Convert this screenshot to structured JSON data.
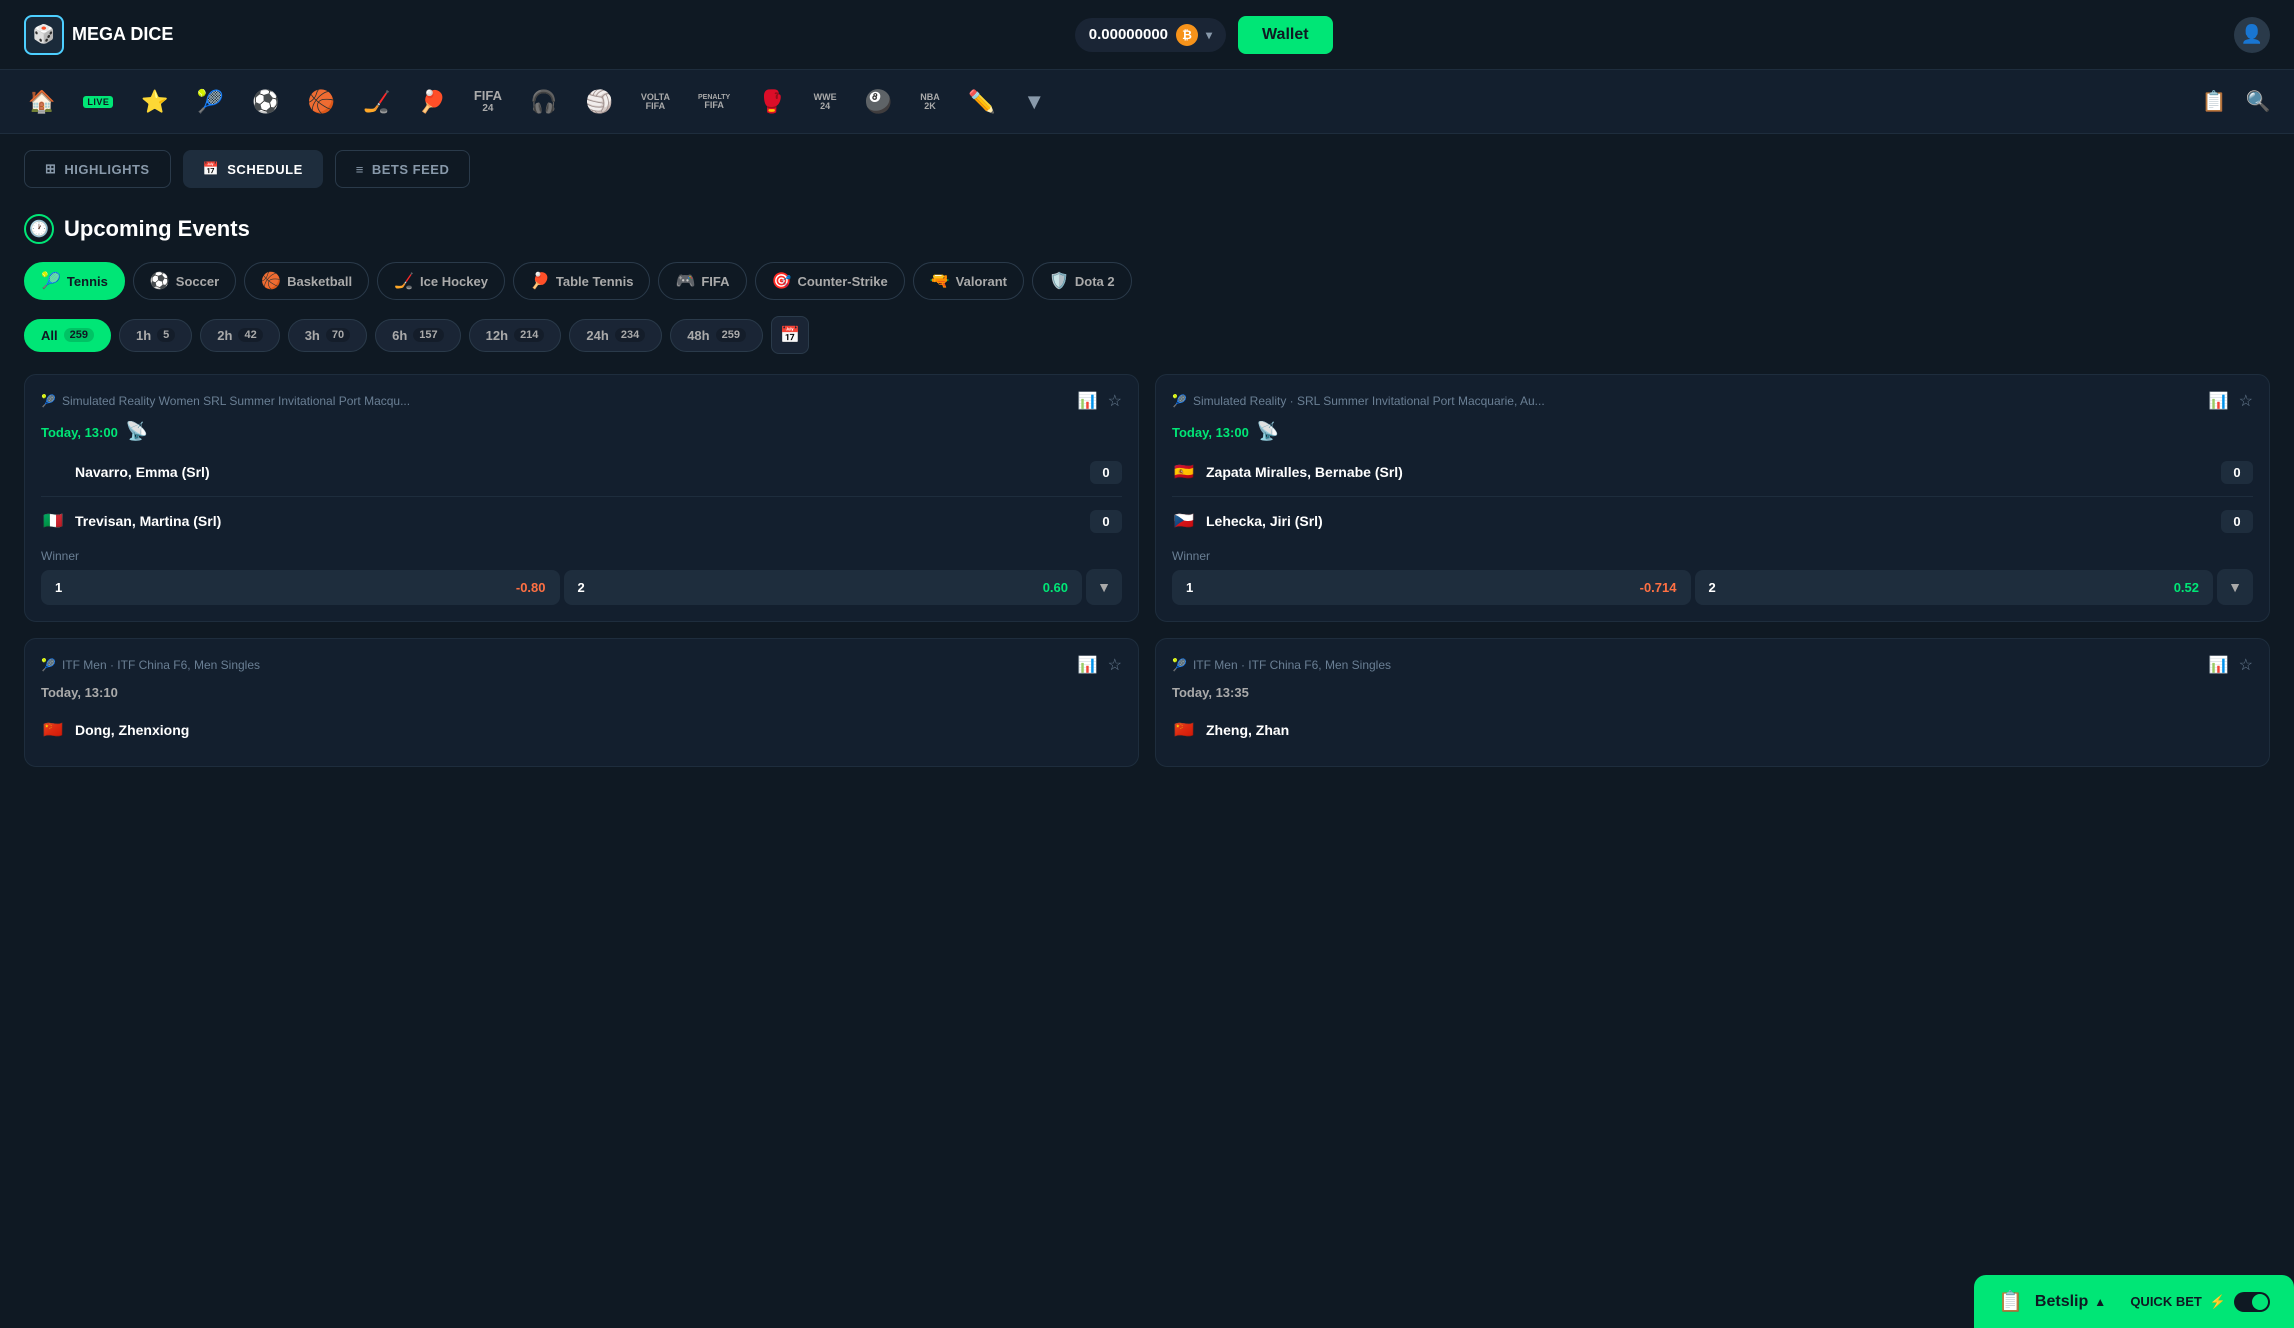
{
  "header": {
    "logo": "MEGA DICE",
    "balance": "0.00000000",
    "currency": "BTC",
    "wallet_label": "Wallet"
  },
  "nav": {
    "items": [
      {
        "id": "home",
        "icon": "🏠",
        "label": "Home"
      },
      {
        "id": "live",
        "icon": "LIVE",
        "label": "Live"
      },
      {
        "id": "favorites",
        "icon": "⭐",
        "label": "Favorites"
      },
      {
        "id": "tennis",
        "icon": "🎾",
        "label": "Tennis"
      },
      {
        "id": "soccer",
        "icon": "⚽",
        "label": "Soccer"
      },
      {
        "id": "basketball",
        "icon": "🏀",
        "label": "Basketball"
      },
      {
        "id": "hockey-stick",
        "icon": "🏒",
        "label": "Ice Hockey"
      },
      {
        "id": "table-tennis",
        "icon": "🏓",
        "label": "Table Tennis"
      },
      {
        "id": "fifa24",
        "icon": "FIFA\n24",
        "label": "FIFA 24"
      },
      {
        "id": "esports",
        "icon": "🎧",
        "label": "Esports"
      },
      {
        "id": "volleyball",
        "icon": "🏐",
        "label": "Volleyball"
      },
      {
        "id": "volta",
        "icon": "VOLTA\nFIFA",
        "label": "Volta FIFA"
      },
      {
        "id": "penalty",
        "icon": "PENALTY\nFIFA",
        "label": "Penalty FIFA"
      },
      {
        "id": "futsal",
        "icon": "🥊",
        "label": "Futsal"
      },
      {
        "id": "wwe",
        "icon": "WWE\n24",
        "label": "WWE 24"
      },
      {
        "id": "pool",
        "icon": "🎱",
        "label": "Pool"
      },
      {
        "id": "nba2k",
        "icon": "NBA\n2K",
        "label": "NBA 2K"
      },
      {
        "id": "more",
        "icon": "✏️",
        "label": "More"
      },
      {
        "id": "expand",
        "icon": "▼",
        "label": "Expand"
      }
    ],
    "right_items": [
      {
        "id": "betslip-nav",
        "icon": "📋"
      },
      {
        "id": "search-nav",
        "icon": "🔍"
      }
    ]
  },
  "tabs": [
    {
      "id": "highlights",
      "label": "HIGHLIGHTS",
      "icon": "⊞",
      "active": false
    },
    {
      "id": "schedule",
      "label": "SCHEDULE",
      "icon": "📅",
      "active": true
    },
    {
      "id": "bets-feed",
      "label": "BETS FEED",
      "icon": "≡",
      "active": false
    }
  ],
  "upcoming": {
    "title": "Upcoming Events",
    "sports": [
      {
        "id": "tennis",
        "icon": "🎾",
        "label": "Tennis",
        "active": true
      },
      {
        "id": "soccer",
        "icon": "⚽",
        "label": "Soccer",
        "active": false
      },
      {
        "id": "basketball",
        "icon": "🏀",
        "label": "Basketball",
        "active": false
      },
      {
        "id": "ice-hockey",
        "icon": "🏒",
        "label": "Ice Hockey",
        "active": false
      },
      {
        "id": "table-tennis",
        "icon": "🏓",
        "label": "Table Tennis",
        "active": false
      },
      {
        "id": "fifa",
        "icon": "🎮",
        "label": "FIFA",
        "active": false
      },
      {
        "id": "counter-strike",
        "icon": "🎯",
        "label": "Counter-Strike",
        "active": false
      },
      {
        "id": "valorant",
        "icon": "🔫",
        "label": "Valorant",
        "active": false
      },
      {
        "id": "dota2",
        "icon": "🛡️",
        "label": "Dota 2",
        "active": false
      }
    ],
    "time_filters": [
      {
        "id": "all",
        "label": "All",
        "count": 259,
        "active": true
      },
      {
        "id": "1h",
        "label": "1h",
        "count": 5,
        "active": false
      },
      {
        "id": "2h",
        "label": "2h",
        "count": 42,
        "active": false
      },
      {
        "id": "3h",
        "label": "3h",
        "count": 70,
        "active": false
      },
      {
        "id": "6h",
        "label": "6h",
        "count": 157,
        "active": false
      },
      {
        "id": "12h",
        "label": "12h",
        "count": 214,
        "active": false
      },
      {
        "id": "24h",
        "label": "24h",
        "count": 234,
        "active": false
      },
      {
        "id": "48h",
        "label": "48h",
        "count": 259,
        "active": false
      }
    ],
    "events": [
      {
        "id": "event1",
        "meta": "Simulated Reality Women SRL Summer Invitational Port Macqu...",
        "time": "Today, 13:00",
        "live": true,
        "player1": {
          "name": "Navarro, Emma (Srl)",
          "flag": "",
          "score": "0"
        },
        "player2": {
          "name": "Trevisan, Martina (Srl)",
          "flag": "🇮🇹",
          "score": "0"
        },
        "winner_label": "Winner",
        "odds": [
          {
            "side": "1",
            "val": "-0.80",
            "positive": false
          },
          {
            "side": "2",
            "val": "0.60",
            "positive": true
          }
        ]
      },
      {
        "id": "event2",
        "meta": "Simulated Reality · SRL Summer Invitational Port Macquarie, Au...",
        "time": "Today, 13:00",
        "live": true,
        "player1": {
          "name": "Zapata Miralles, Bernabe (Srl)",
          "flag": "🇪🇸",
          "score": "0"
        },
        "player2": {
          "name": "Lehecka, Jiri (Srl)",
          "flag": "🇨🇿",
          "score": "0"
        },
        "winner_label": "Winner",
        "odds": [
          {
            "side": "1",
            "val": "-0.714",
            "positive": false
          },
          {
            "side": "2",
            "val": "0.52",
            "positive": true
          }
        ]
      },
      {
        "id": "event3",
        "meta": "ITF Men · ITF China F6, Men Singles",
        "time": "Today, 13:10",
        "live": false,
        "player1": {
          "name": "Dong, Zhenxiong",
          "flag": "🇨🇳",
          "score": ""
        },
        "player2": {
          "name": "",
          "flag": "",
          "score": ""
        },
        "winner_label": "",
        "odds": []
      },
      {
        "id": "event4",
        "meta": "ITF Men · ITF China F6, Men Singles",
        "time": "Today, 13:35",
        "live": false,
        "player1": {
          "name": "Zheng, Zhan",
          "flag": "🇨🇳",
          "score": ""
        },
        "player2": {
          "name": "",
          "flag": "",
          "score": ""
        },
        "winner_label": "",
        "odds": []
      }
    ]
  },
  "betslip": {
    "label": "Betslip",
    "arrow": "▲",
    "quick_bet_label": "QUICK BET",
    "toggle_icon": "⚡"
  }
}
